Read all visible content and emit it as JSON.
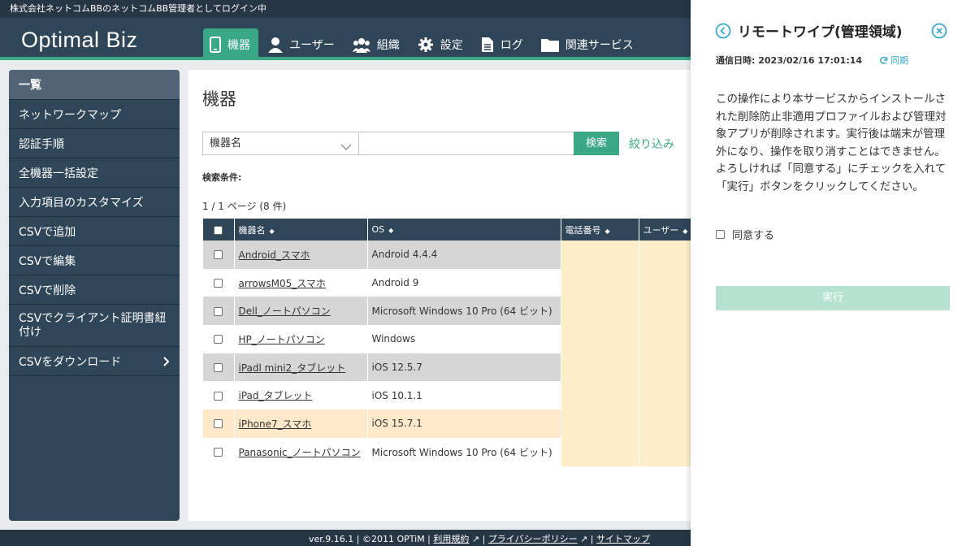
{
  "topbar": {
    "login_text": "株式会社ネットコムBBのネットコムBB管理者としてログイン中"
  },
  "header": {
    "logo": "Optimal Biz",
    "nav": [
      {
        "label": "機器",
        "icon": "phone-icon",
        "active": true
      },
      {
        "label": "ユーザー",
        "icon": "user-icon"
      },
      {
        "label": "組織",
        "icon": "group-icon"
      },
      {
        "label": "設定",
        "icon": "gear-icon"
      },
      {
        "label": "ログ",
        "icon": "document-icon"
      },
      {
        "label": "関連サービス",
        "icon": "folder-icon"
      }
    ]
  },
  "sidebar": {
    "items": [
      {
        "label": "一覧"
      },
      {
        "label": "ネットワークマップ"
      },
      {
        "label": "認証手順"
      },
      {
        "label": "全機器一括設定"
      },
      {
        "label": "入力項目のカスタマイズ"
      },
      {
        "label": "CSVで追加"
      },
      {
        "label": "CSVで編集"
      },
      {
        "label": "CSVで削除"
      },
      {
        "label": "CSVでクライアント証明書紐付け"
      },
      {
        "label": "CSVをダウンロード"
      }
    ]
  },
  "main": {
    "title": "機器",
    "search": {
      "field_select": "機器名",
      "input_value": "",
      "button": "検索",
      "filter_link": "絞り込み"
    },
    "conditions_label": "検索条件:",
    "pager": "1 / 1 ページ (8 件)",
    "columns": [
      "機器名",
      "OS",
      "電話番号",
      "ユーザー"
    ],
    "rows": [
      {
        "name": "Android_スマホ",
        "os": "Android 4.4.4"
      },
      {
        "name": "arrowsM05_スマホ",
        "os": "Android 9"
      },
      {
        "name": "Dell_ノートパソコン",
        "os": "Microsoft Windows 10 Pro (64 ビット)"
      },
      {
        "name": "HP_ノートパソコン",
        "os": "Windows"
      },
      {
        "name": "iPadl mini2_タブレット",
        "os": "iOS 12.5.7"
      },
      {
        "name": "iPad_タブレット",
        "os": "iOS 10.1.1"
      },
      {
        "name": "iPhone7_スマホ",
        "os": "iOS 15.7.1"
      },
      {
        "name": "Panasonic_ノートパソコン",
        "os": "Microsoft Windows 10 Pro (64 ビット)"
      }
    ]
  },
  "footer": {
    "version": "ver.9.16.1 | ©2011 OPTiM |",
    "terms": "利用規約",
    "privacy": "プライバシーポリシー",
    "sitemap": "サイトマップ"
  },
  "drawer": {
    "title": "リモートワイプ(管理領域)",
    "comm_date": "通信日時: 2023/02/16 17:01:14",
    "sync_label": "同期",
    "warning": "この操作により本サービスからインストールされた削除防止非適用プロファイルおよび管理対象アプリが削除されます。実行後は端末が管理外になり、操作を取り消すことはできません。よろしければ「同意する」にチェックを入れて「実行」ボタンをクリックしてください。",
    "agree_label": "同意する",
    "execute_label": "実行"
  },
  "colors": {
    "header": "#2f4558",
    "accent": "#3aa886",
    "highlight_row": "#fde9c9",
    "link_blue": "#3aa9c9"
  }
}
